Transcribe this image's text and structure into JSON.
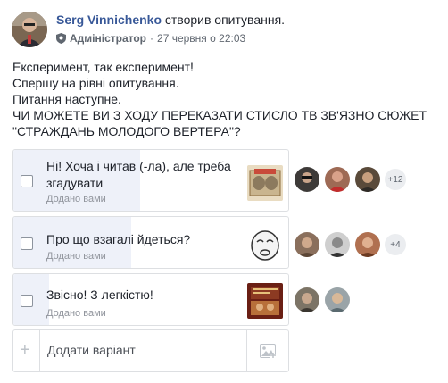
{
  "post": {
    "author": "Serg Vinnichenko",
    "action": "створив опитування.",
    "role": "Адміністратор",
    "separator": "·",
    "timestamp": "27 червня о 22:03",
    "text_lines": [
      "Експеримент, так експеримент!",
      "Спершу на рівні опитування.",
      "Питання наступне.",
      "ЧИ МОЖЕТЕ ВИ З ХОДУ ПЕРЕКАЗАТИ СТИСЛО ТВ ЗВ'ЯЗНО СЮЖЕТ",
      "\"СТРАЖДАНЬ МОЛОДОГО ВЕРТЕРА\"?"
    ]
  },
  "poll": {
    "options": [
      {
        "label_lines": [
          "Ні! Хоча і читав (-ла), але треба",
          "згадувати"
        ],
        "added_by": "Додано вами",
        "more_count": "+12",
        "vote_share": 0.46
      },
      {
        "label_lines": [
          "Про що взагалі йдеться?"
        ],
        "added_by": "Додано вами",
        "more_count": "+4",
        "vote_share": 0.43
      },
      {
        "label_lines": [
          "Звісно! З легкістю!"
        ],
        "added_by": "Додано вами",
        "more_count": "",
        "vote_share": 0.13
      }
    ],
    "add_option_placeholder": "Додати варіант",
    "add_symbol": "+"
  },
  "icons": [
    "shield-icon",
    "plus-icon",
    "photo-icon"
  ],
  "colors": {
    "link": "#385898",
    "bar_fill": "#eef1f9",
    "border": "#dddfe2",
    "meta": "#606770"
  }
}
